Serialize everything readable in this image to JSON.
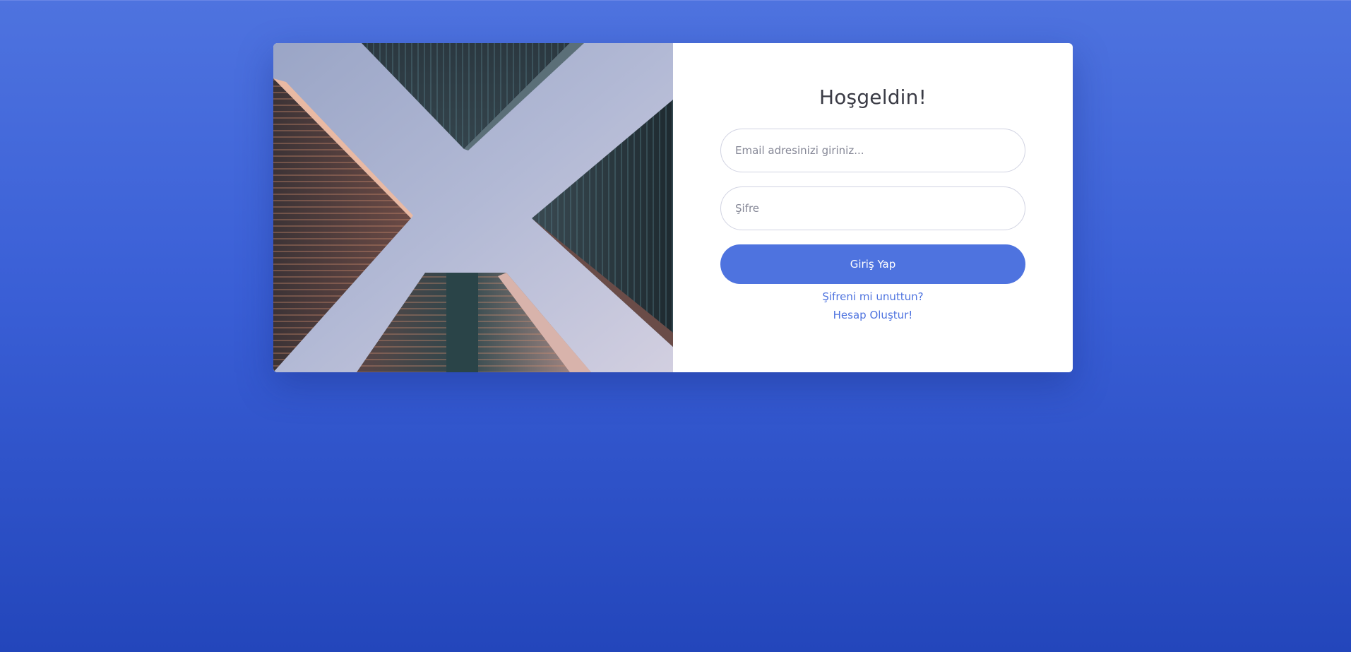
{
  "login": {
    "title": "Hoşgeldin!",
    "email_placeholder": "Email adresinizi giriniz...",
    "password_placeholder": "Şifre",
    "submit_label": "Giriş Yap",
    "forgot_link": "Şifreni mi unuttun?",
    "register_link": "Hesap Oluştur!"
  },
  "image": {
    "subject": "skyscrapers-from-below-photo"
  },
  "colors": {
    "primary": "#4e73df",
    "background_top": "#4e73df",
    "background_bottom": "#2346bb",
    "card": "#ffffff",
    "title_text": "#3a3b45",
    "border": "#d1d3e2"
  }
}
